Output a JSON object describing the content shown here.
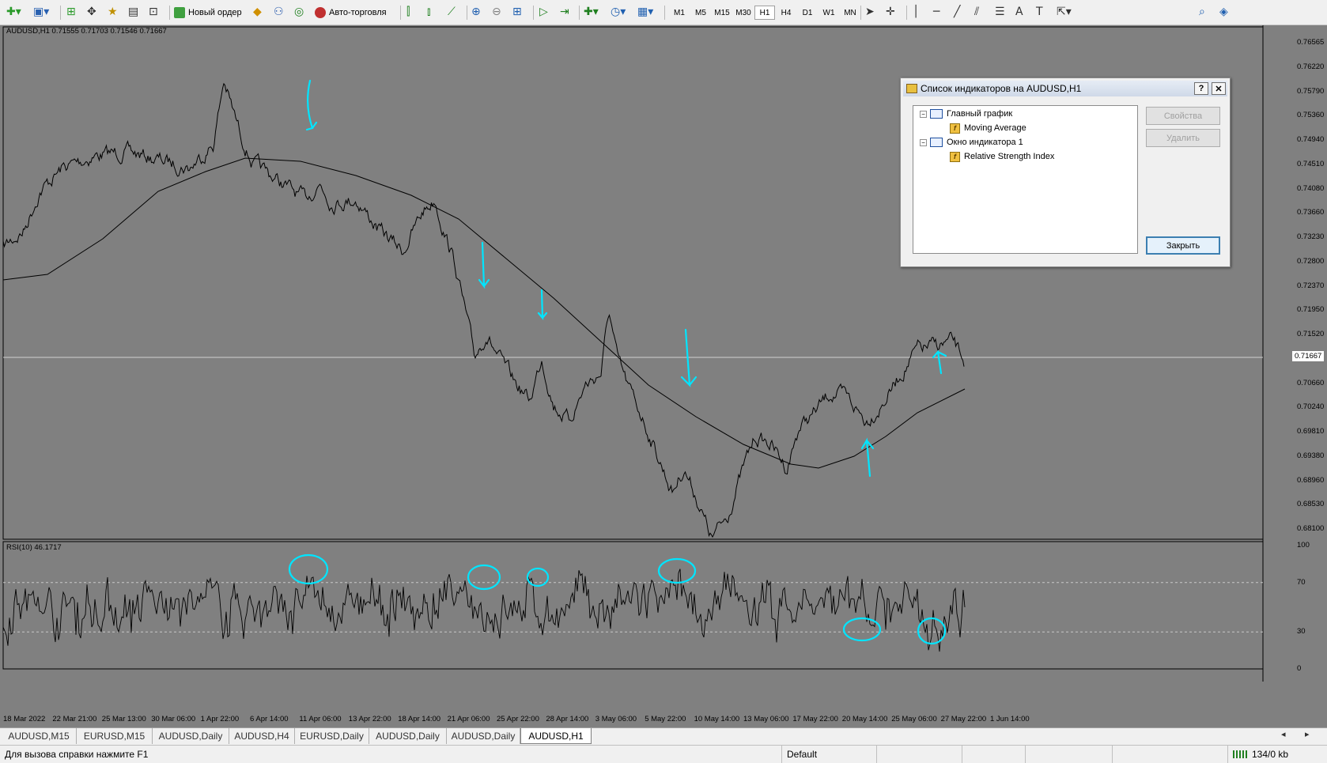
{
  "toolbar": {
    "new_order_label": "Новый ордер",
    "autotrading_label": "Авто-торговля",
    "timeframes": [
      "M1",
      "M5",
      "M15",
      "M30",
      "H1",
      "H4",
      "D1",
      "W1",
      "MN"
    ],
    "active_timeframe": "H1"
  },
  "chart": {
    "header": "AUDUSD,H1  0.71555 0.71703 0.71546 0.71667",
    "current_price": "0.71667",
    "price_ticks": [
      "0.76565",
      "0.76220",
      "0.75790",
      "0.75360",
      "0.74940",
      "0.74510",
      "0.74080",
      "0.73660",
      "0.73230",
      "0.72800",
      "0.72370",
      "0.71950",
      "0.71520",
      "0.71090",
      "0.70660",
      "0.70240",
      "0.69810",
      "0.69380",
      "0.68960",
      "0.68530",
      "0.68100"
    ],
    "time_ticks": [
      "18 Mar 2022",
      "22 Mar 21:00",
      "25 Mar 13:00",
      "30 Mar 06:00",
      "1 Apr 22:00",
      "6 Apr 14:00",
      "11 Apr 06:00",
      "13 Apr 22:00",
      "18 Apr 14:00",
      "21 Apr 06:00",
      "25 Apr 22:00",
      "28 Apr 14:00",
      "3 May 06:00",
      "5 May 22:00",
      "10 May 14:00",
      "13 May 06:00",
      "17 May 22:00",
      "20 May 14:00",
      "25 May 06:00",
      "27 May 22:00",
      "1 Jun 14:00"
    ]
  },
  "rsi": {
    "header": "RSI(10) 46.1717",
    "ticks": [
      "100",
      "70",
      "30",
      "0"
    ]
  },
  "dialog": {
    "title": "Список индикаторов на AUDUSD,H1",
    "help_label": "?",
    "close_x": "✕",
    "tree": {
      "main_chart": "Главный график",
      "moving_average": "Moving Average",
      "indicator_window": "Окно индикатора 1",
      "rsi": "Relative Strength Index"
    },
    "properties_label": "Свойства",
    "delete_label": "Удалить",
    "close_label": "Закрыть"
  },
  "tabs": [
    "AUDUSD,M15",
    "EURUSD,M15",
    "AUDUSD,Daily",
    "AUDUSD,H4",
    "EURUSD,Daily",
    "AUDUSD,Daily",
    "AUDUSD,Daily",
    "AUDUSD,H1"
  ],
  "active_tab": "AUDUSD,H1",
  "status": {
    "help_text": "Для вызова справки нажмите F1",
    "profile": "Default",
    "traffic": "134/0 kb"
  },
  "colors": {
    "chart_bg": "#808080",
    "annotation": "#00e5ff",
    "price_line": "#000000",
    "grid_text": "#000000"
  }
}
